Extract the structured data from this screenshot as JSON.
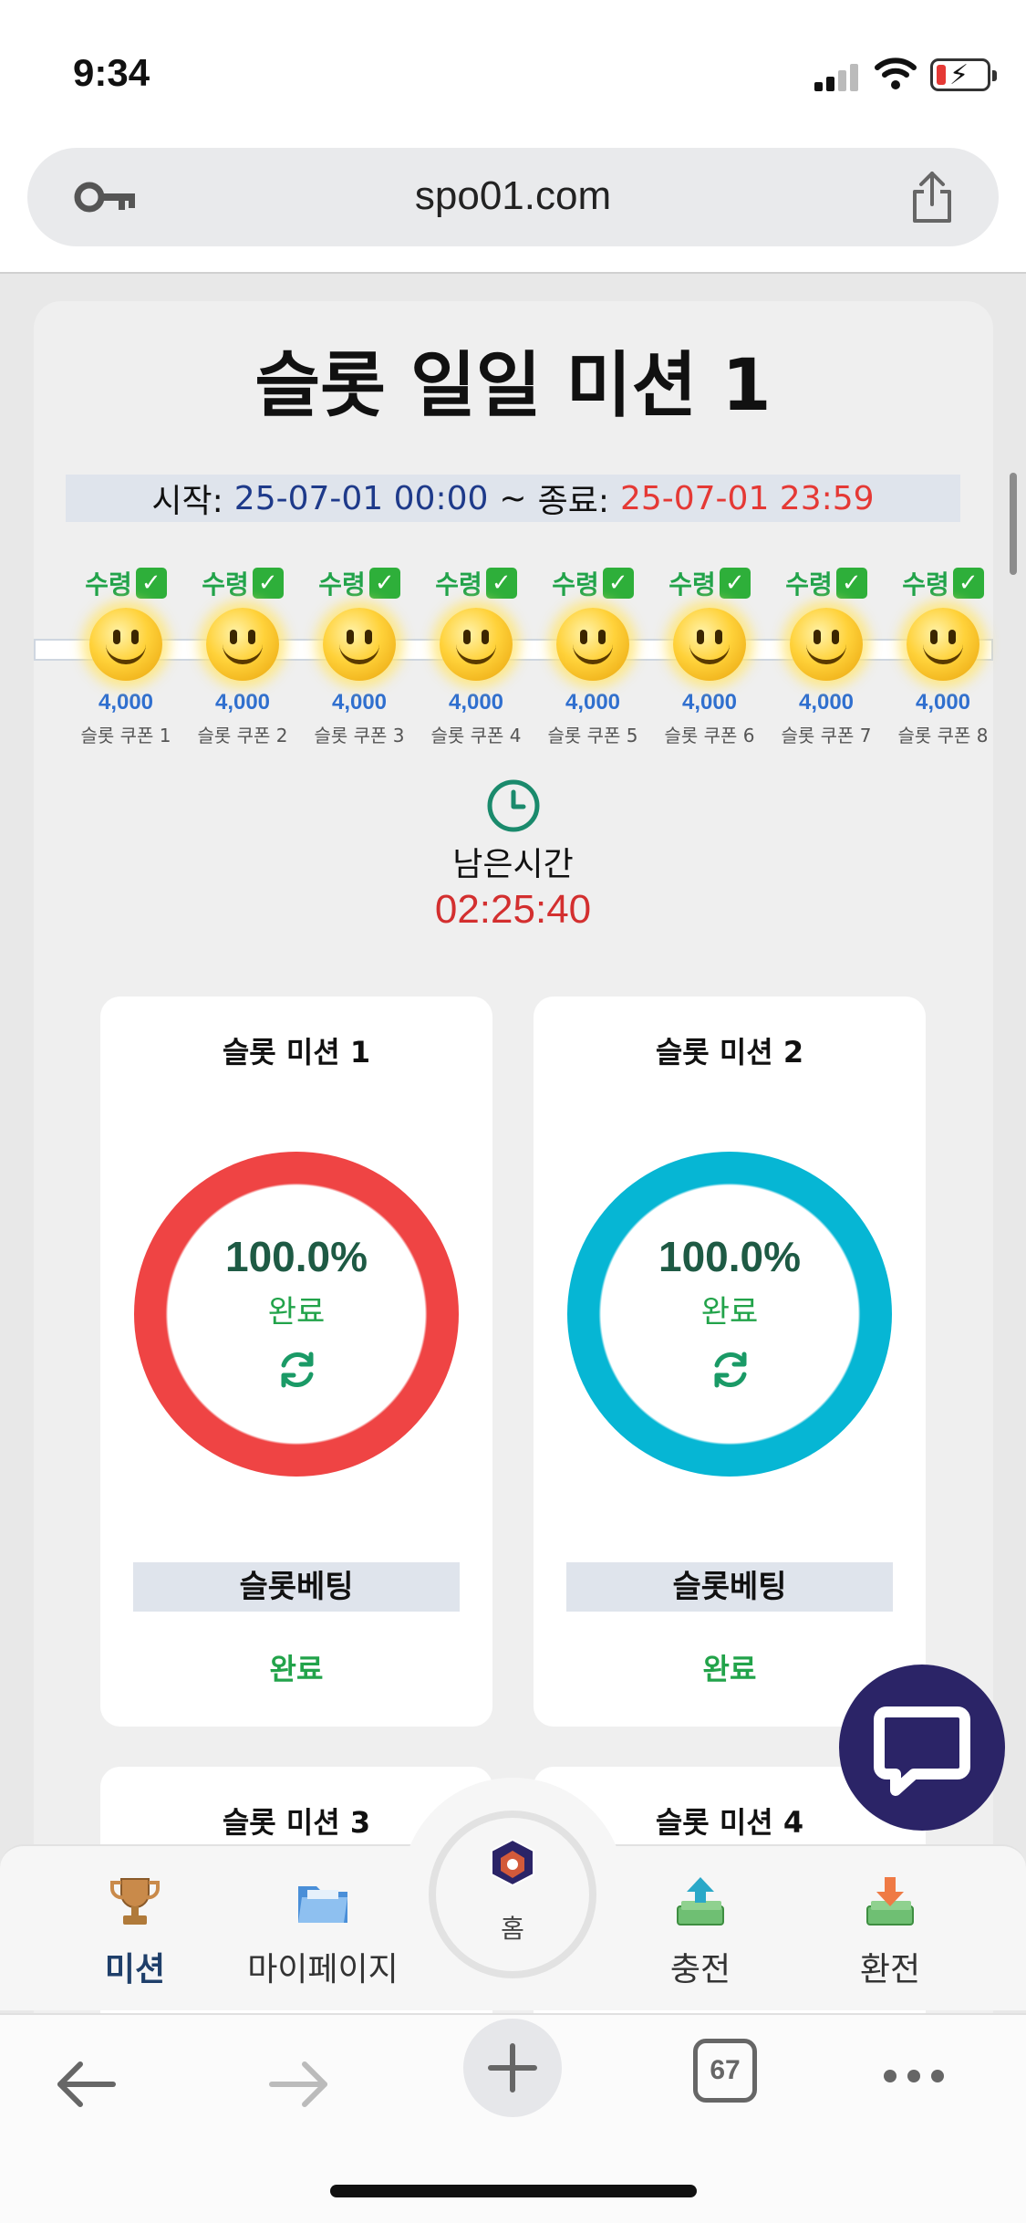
{
  "status_bar": {
    "time": "9:34"
  },
  "browser": {
    "url": "spo01.com",
    "tab_count": "67"
  },
  "page": {
    "title": "슬롯 일일 미션 1",
    "period": {
      "start_label": "시작:",
      "start": "25-07-01 00:00",
      "separator": "~",
      "end_label": "종료:",
      "end": "25-07-01 23:59"
    },
    "coupons": [
      {
        "status": "수령",
        "amount": "4,000",
        "name": "슬롯 쿠폰 1"
      },
      {
        "status": "수령",
        "amount": "4,000",
        "name": "슬롯 쿠폰 2"
      },
      {
        "status": "수령",
        "amount": "4,000",
        "name": "슬롯 쿠폰 3"
      },
      {
        "status": "수령",
        "amount": "4,000",
        "name": "슬롯 쿠폰 4"
      },
      {
        "status": "수령",
        "amount": "4,000",
        "name": "슬롯 쿠폰 5"
      },
      {
        "status": "수령",
        "amount": "4,000",
        "name": "슬롯 쿠폰 6"
      },
      {
        "status": "수령",
        "amount": "4,000",
        "name": "슬롯 쿠폰 7"
      },
      {
        "status": "수령",
        "amount": "4,000",
        "name": "슬롯 쿠폰 8"
      }
    ],
    "remaining": {
      "label": "남은시간",
      "value": "02:25:40"
    },
    "missions": [
      {
        "title": "슬롯 미션 1",
        "percent": "100.0%",
        "progress_fraction": 1.0,
        "done_label": "완료",
        "ring_color": "#ef4444",
        "bet_type": "슬롯베팅",
        "status": "완료"
      },
      {
        "title": "슬롯 미션 2",
        "percent": "100.0%",
        "progress_fraction": 1.0,
        "done_label": "완료",
        "ring_color": "#06b6d4",
        "bet_type": "슬롯베팅",
        "status": "완료"
      },
      {
        "title": "슬롯 미션 3"
      },
      {
        "title": "슬롯 미션 4"
      }
    ]
  },
  "bottom_nav": {
    "items": [
      {
        "label": "미션",
        "icon": "trophy-icon",
        "active": true
      },
      {
        "label": "마이페이지",
        "icon": "folder-icon",
        "active": false
      },
      {
        "label": "홈",
        "icon": "home-logo-icon",
        "active": false
      },
      {
        "label": "충전",
        "icon": "deposit-money-icon",
        "active": false
      },
      {
        "label": "환전",
        "icon": "withdraw-money-icon",
        "active": false
      }
    ]
  },
  "colors": {
    "accent_green": "#22a34a",
    "start_blue": "#1e3a8a",
    "end_red": "#e53935",
    "timer_red": "#d32f2f",
    "chat_button": "#2b2467"
  }
}
